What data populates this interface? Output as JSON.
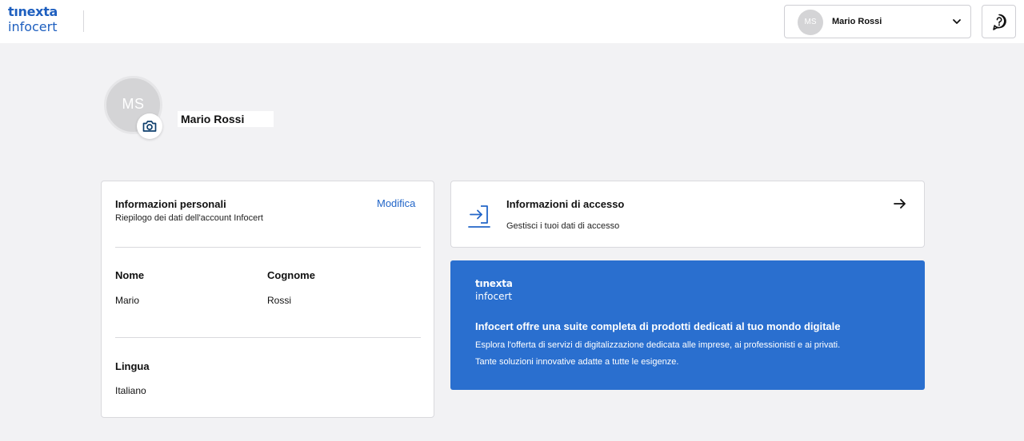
{
  "header": {
    "logo_line1": "tınexta",
    "logo_line2": "infocert",
    "user": {
      "initials": "MS",
      "name": "Mario Rossi"
    }
  },
  "profile": {
    "initials": "MS",
    "name": "Mario Rossi"
  },
  "personal_info": {
    "title": "Informazioni personali",
    "subtitle": "Riepilogo dei dati dell'account Infocert",
    "edit_label": "Modifica",
    "first_name_label": "Nome",
    "first_name_value": "Mario",
    "last_name_label": "Cognome",
    "last_name_value": "Rossi",
    "language_label": "Lingua",
    "language_value": "Italiano"
  },
  "access_info": {
    "title": "Informazioni di accesso",
    "subtitle": "Gestisci i tuoi dati di accesso"
  },
  "promo": {
    "logo_line1": "tınexta",
    "logo_line2": "infocert",
    "title": "Infocert offre una suite completa di prodotti dedicati al tuo mondo digitale",
    "text_line1": "Esplora l'offerta di servizi di digitalizzazione dedicata alle imprese, ai professionisti e ai privati.",
    "text_line2": "Tante soluzioni innovative adatte a tutte le esigenze."
  },
  "colors": {
    "brand_blue": "#1e5fbf",
    "link_blue": "#2366c8",
    "banner_blue": "#2a6fcf",
    "avatar_gray": "#d4d4d6"
  },
  "icons": [
    "chevron-down-icon",
    "help-icon",
    "camera-icon",
    "login-icon",
    "arrow-right-icon"
  ]
}
